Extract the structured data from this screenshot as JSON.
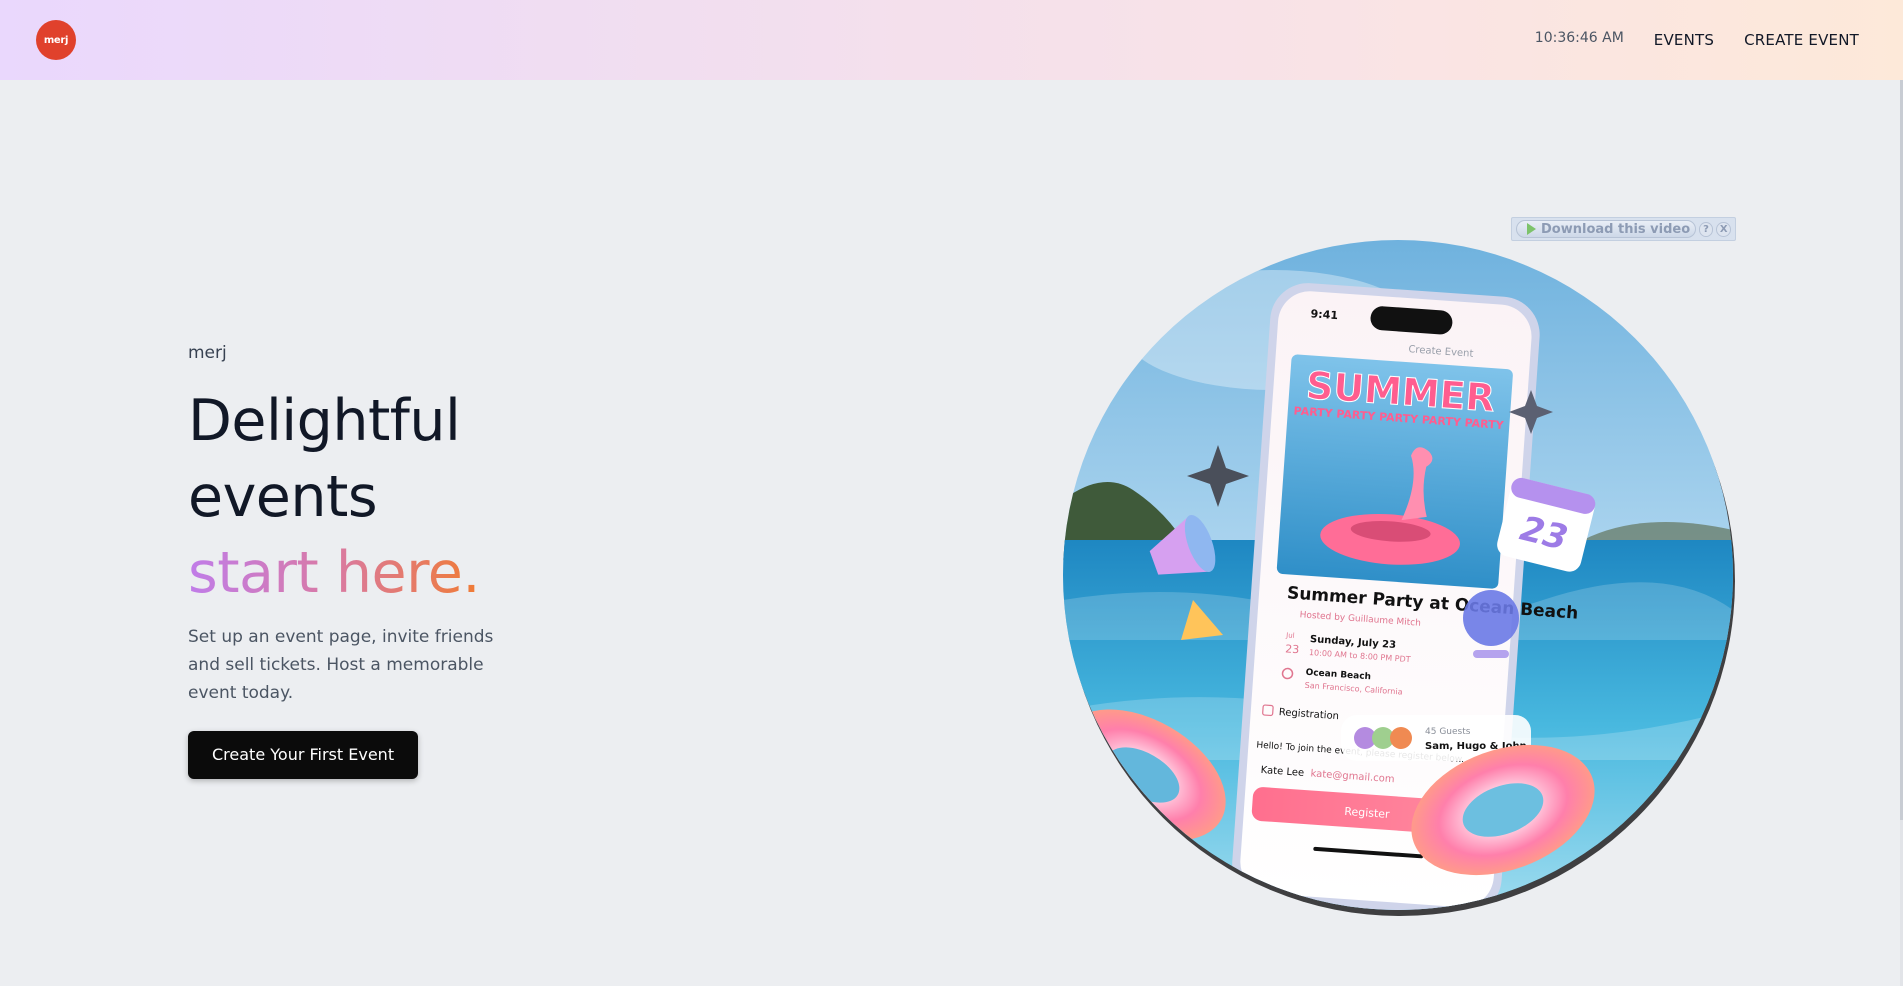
{
  "header": {
    "logo_text": "merj",
    "clock": "10:36:46 AM",
    "nav": {
      "events": "EVENTS",
      "create_event": "CREATE EVENT"
    }
  },
  "hero": {
    "brand": "merj",
    "headline_line1": "Delightful",
    "headline_line2": "events",
    "headline_accent": "start here.",
    "subtitle": "Set up an event page, invite friends and sell tickets. Host a memorable event today.",
    "cta_label": "Create Your First Event"
  },
  "video_overlay": {
    "download_label": "Download this video",
    "help_label": "?",
    "close_label": "X"
  },
  "mockup": {
    "status_time": "9:41",
    "app_link": "Create Event",
    "poster_title": "SUMMER",
    "poster_sub": "PARTY PARTY PARTY PARTY PARTY",
    "event_title": "Summer Party at Ocean Beach",
    "host": "Hosted by Guillaume Mitch",
    "date_month": "Jul",
    "date_day": "23",
    "date_text": "Sunday, July 23",
    "time_text": "10:00 AM to 8:00 PM PDT",
    "location": "Ocean Beach",
    "location_sub": "San Francisco, California",
    "guests_count": "45 Guests",
    "guests_names": "Sam, Hugo & John",
    "registration": "Registration",
    "register_msg": "Hello! To join the event, please register below.",
    "attendee_name": "Kate Lee",
    "attendee_email": "kate@gmail.com",
    "register_btn": "Register",
    "calendar_day": "23"
  },
  "colors": {
    "logo": "#e0412c",
    "cta": "#0b0b0b",
    "accent_start": "#c07ce9",
    "accent_end": "#f07b34",
    "background": "#eceef1"
  }
}
